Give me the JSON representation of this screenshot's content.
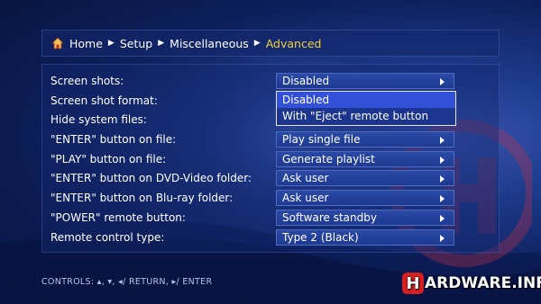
{
  "breadcrumb": {
    "items": [
      "Home",
      "Setup",
      "Miscellaneous"
    ],
    "current": "Advanced"
  },
  "settings": [
    {
      "label": "Screen shots:",
      "value": "Disabled"
    },
    {
      "label": "Screen shot format:",
      "value": ""
    },
    {
      "label": "Hide system files:",
      "value": ""
    },
    {
      "label": "\"ENTER\" button on file:",
      "value": "Play single file"
    },
    {
      "label": "\"PLAY\" button on file:",
      "value": "Generate playlist"
    },
    {
      "label": "\"ENTER\" button on DVD-Video folder:",
      "value": "Ask user"
    },
    {
      "label": "\"ENTER\" button on Blu-ray folder:",
      "value": "Ask user"
    },
    {
      "label": "\"POWER\" remote button:",
      "value": "Software standby"
    },
    {
      "label": "Remote control type:",
      "value": "Type 2 (Black)"
    }
  ],
  "dropdown": {
    "options": [
      "Disabled",
      "With \"Eject\" remote button"
    ],
    "selected": "Disabled"
  },
  "controls_hint": "CONTROLS:  ▴, ▾, ◂/ RETURN, ▸/ ENTER",
  "logo": {
    "mark": "H",
    "text": "ARDWARE.INFO"
  },
  "colors": {
    "accent": "#f2d23a",
    "highlight": "#3350d8",
    "logo_red": "#d42020"
  }
}
